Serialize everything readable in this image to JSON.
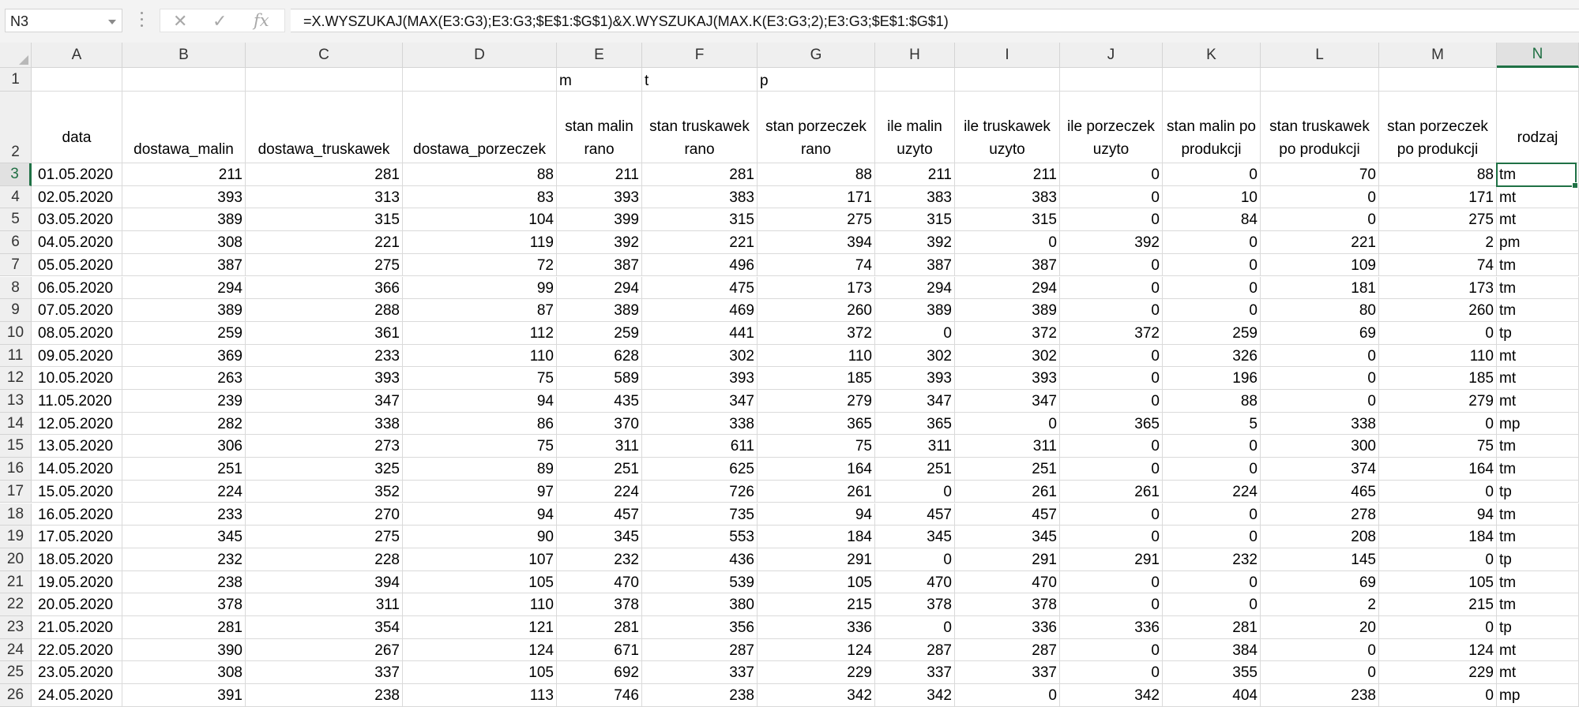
{
  "name_box": "N3",
  "formula_icons": {
    "cancel": "✕",
    "enter": "✓",
    "fx": "fx"
  },
  "formula": "=X.WYSZUKAJ(MAX(E3:G3);E3:G3;$E$1:$G$1)&X.WYSZUKAJ(MAX.K(E3:G3;2);E3:G3;$E$1:$G$1)",
  "columns": [
    "A",
    "B",
    "C",
    "D",
    "E",
    "F",
    "G",
    "H",
    "I",
    "J",
    "K",
    "L",
    "M",
    "N"
  ],
  "selected_column": "N",
  "selected_row": "3",
  "row1": {
    "E": "m",
    "F": "t",
    "G": "p"
  },
  "headers": [
    "data",
    "dostawa_malin",
    "dostawa_truskawek",
    "dostawa_porzeczek",
    "stan malin rano",
    "stan truskawek rano",
    "stan porzeczek rano",
    "ile malin uzyto",
    "ile truskawek uzyto",
    "ile porzeczek uzyto",
    "stan malin po produkcji",
    "stan truskawek po produkcji",
    "stan porzeczek po produkcji",
    "rodzaj"
  ],
  "rows": [
    [
      "3",
      "01.05.2020",
      "211",
      "281",
      "88",
      "211",
      "281",
      "88",
      "211",
      "211",
      "0",
      "0",
      "70",
      "88",
      "tm"
    ],
    [
      "4",
      "02.05.2020",
      "393",
      "313",
      "83",
      "393",
      "383",
      "171",
      "383",
      "383",
      "0",
      "10",
      "0",
      "171",
      "mt"
    ],
    [
      "5",
      "03.05.2020",
      "389",
      "315",
      "104",
      "399",
      "315",
      "275",
      "315",
      "315",
      "0",
      "84",
      "0",
      "275",
      "mt"
    ],
    [
      "6",
      "04.05.2020",
      "308",
      "221",
      "119",
      "392",
      "221",
      "394",
      "392",
      "0",
      "392",
      "0",
      "221",
      "2",
      "pm"
    ],
    [
      "7",
      "05.05.2020",
      "387",
      "275",
      "72",
      "387",
      "496",
      "74",
      "387",
      "387",
      "0",
      "0",
      "109",
      "74",
      "tm"
    ],
    [
      "8",
      "06.05.2020",
      "294",
      "366",
      "99",
      "294",
      "475",
      "173",
      "294",
      "294",
      "0",
      "0",
      "181",
      "173",
      "tm"
    ],
    [
      "9",
      "07.05.2020",
      "389",
      "288",
      "87",
      "389",
      "469",
      "260",
      "389",
      "389",
      "0",
      "0",
      "80",
      "260",
      "tm"
    ],
    [
      "10",
      "08.05.2020",
      "259",
      "361",
      "112",
      "259",
      "441",
      "372",
      "0",
      "372",
      "372",
      "259",
      "69",
      "0",
      "tp"
    ],
    [
      "11",
      "09.05.2020",
      "369",
      "233",
      "110",
      "628",
      "302",
      "110",
      "302",
      "302",
      "0",
      "326",
      "0",
      "110",
      "mt"
    ],
    [
      "12",
      "10.05.2020",
      "263",
      "393",
      "75",
      "589",
      "393",
      "185",
      "393",
      "393",
      "0",
      "196",
      "0",
      "185",
      "mt"
    ],
    [
      "13",
      "11.05.2020",
      "239",
      "347",
      "94",
      "435",
      "347",
      "279",
      "347",
      "347",
      "0",
      "88",
      "0",
      "279",
      "mt"
    ],
    [
      "14",
      "12.05.2020",
      "282",
      "338",
      "86",
      "370",
      "338",
      "365",
      "365",
      "0",
      "365",
      "5",
      "338",
      "0",
      "mp"
    ],
    [
      "15",
      "13.05.2020",
      "306",
      "273",
      "75",
      "311",
      "611",
      "75",
      "311",
      "311",
      "0",
      "0",
      "300",
      "75",
      "tm"
    ],
    [
      "16",
      "14.05.2020",
      "251",
      "325",
      "89",
      "251",
      "625",
      "164",
      "251",
      "251",
      "0",
      "0",
      "374",
      "164",
      "tm"
    ],
    [
      "17",
      "15.05.2020",
      "224",
      "352",
      "97",
      "224",
      "726",
      "261",
      "0",
      "261",
      "261",
      "224",
      "465",
      "0",
      "tp"
    ],
    [
      "18",
      "16.05.2020",
      "233",
      "270",
      "94",
      "457",
      "735",
      "94",
      "457",
      "457",
      "0",
      "0",
      "278",
      "94",
      "tm"
    ],
    [
      "19",
      "17.05.2020",
      "345",
      "275",
      "90",
      "345",
      "553",
      "184",
      "345",
      "345",
      "0",
      "0",
      "208",
      "184",
      "tm"
    ],
    [
      "20",
      "18.05.2020",
      "232",
      "228",
      "107",
      "232",
      "436",
      "291",
      "0",
      "291",
      "291",
      "232",
      "145",
      "0",
      "tp"
    ],
    [
      "21",
      "19.05.2020",
      "238",
      "394",
      "105",
      "470",
      "539",
      "105",
      "470",
      "470",
      "0",
      "0",
      "69",
      "105",
      "tm"
    ],
    [
      "22",
      "20.05.2020",
      "378",
      "311",
      "110",
      "378",
      "380",
      "215",
      "378",
      "378",
      "0",
      "0",
      "2",
      "215",
      "tm"
    ],
    [
      "23",
      "21.05.2020",
      "281",
      "354",
      "121",
      "281",
      "356",
      "336",
      "0",
      "336",
      "336",
      "281",
      "20",
      "0",
      "tp"
    ],
    [
      "24",
      "22.05.2020",
      "390",
      "267",
      "124",
      "671",
      "287",
      "124",
      "287",
      "287",
      "0",
      "384",
      "0",
      "124",
      "mt"
    ],
    [
      "25",
      "23.05.2020",
      "308",
      "337",
      "105",
      "692",
      "337",
      "229",
      "337",
      "337",
      "0",
      "355",
      "0",
      "229",
      "mt"
    ],
    [
      "26",
      "24.05.2020",
      "391",
      "238",
      "113",
      "746",
      "238",
      "342",
      "342",
      "0",
      "342",
      "404",
      "238",
      "0",
      "mp"
    ]
  ]
}
